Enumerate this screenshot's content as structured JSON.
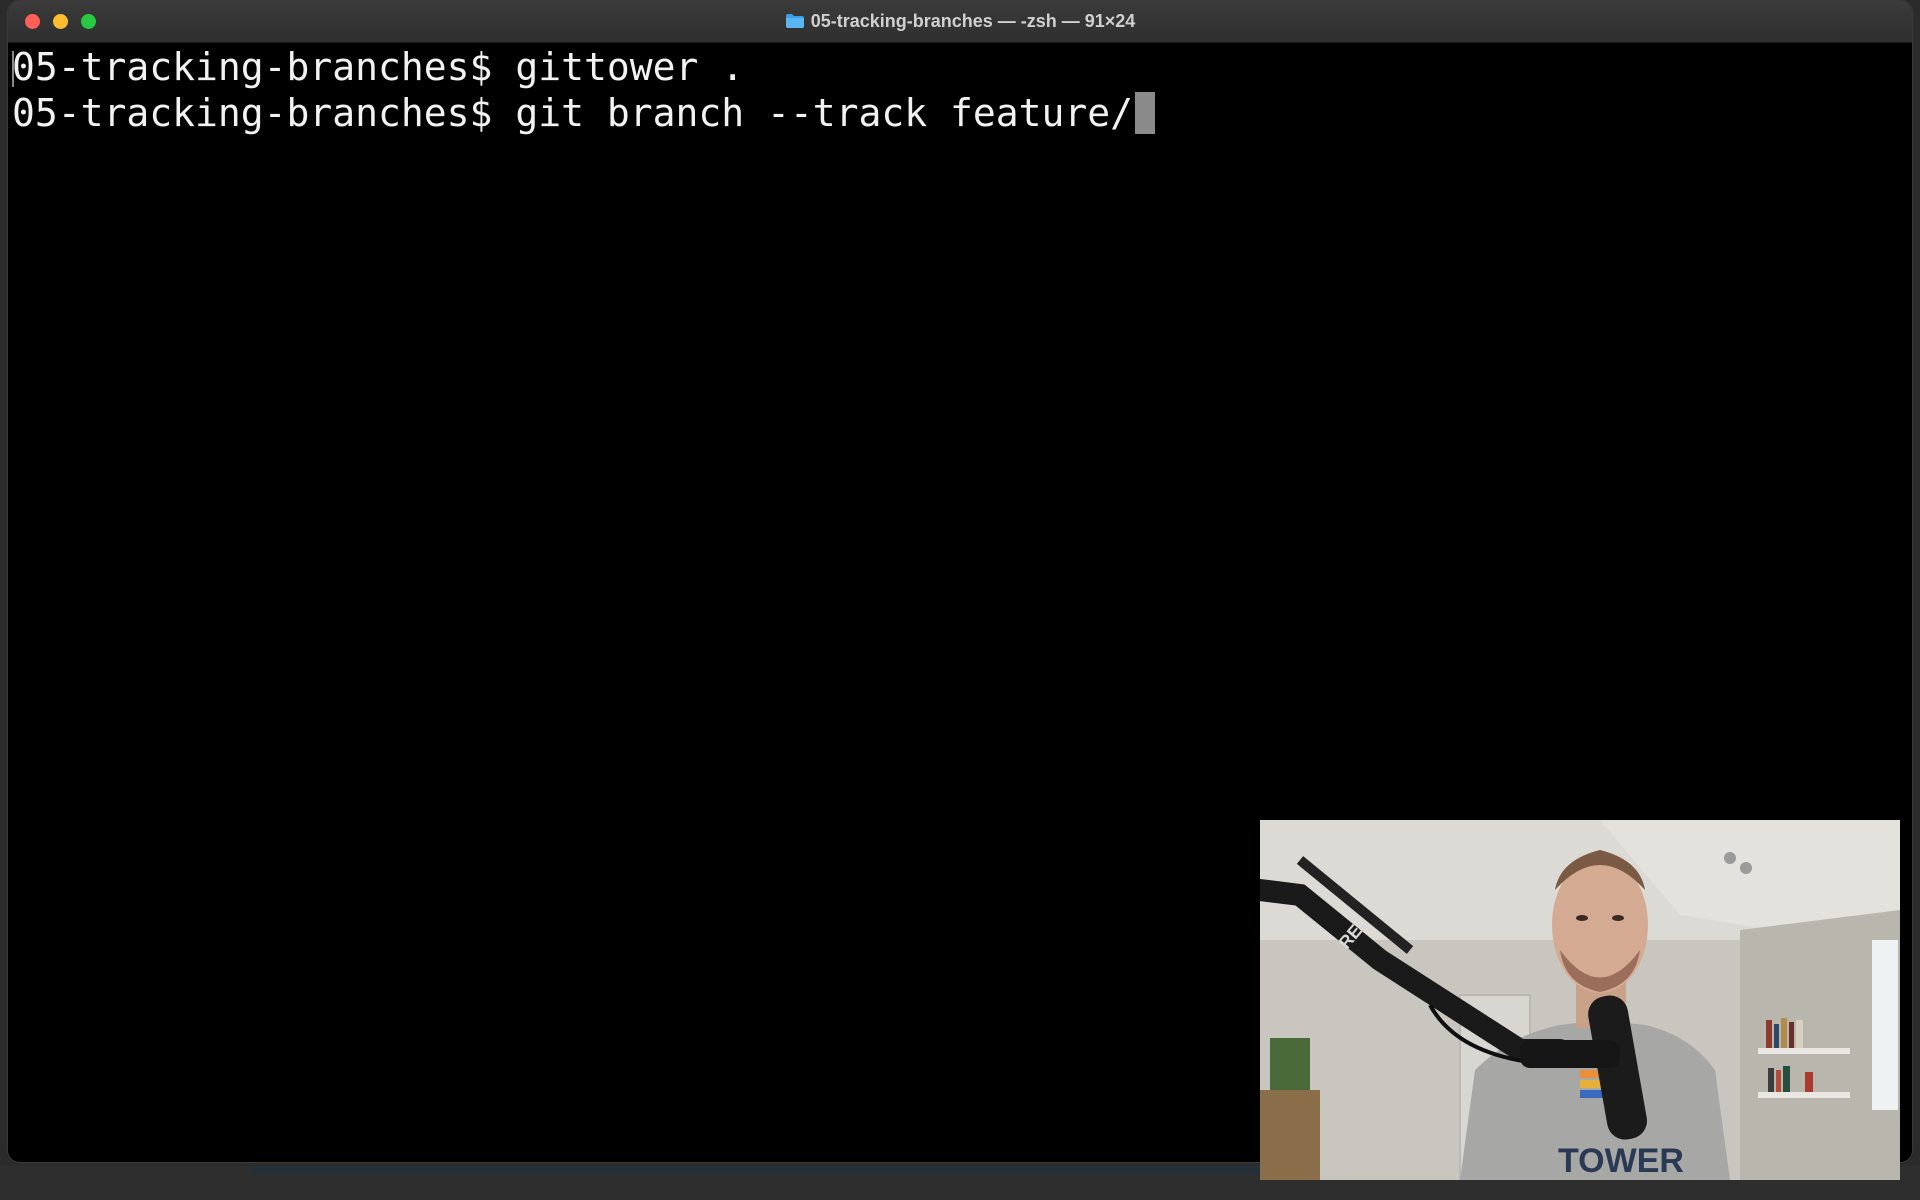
{
  "window": {
    "title": "05-tracking-branches — -zsh — 91×24"
  },
  "terminal": {
    "lines": [
      {
        "prompt": "05-tracking-branches$",
        "command": " gittower ."
      },
      {
        "prompt": "05-tracking-branches$",
        "command": " git branch --track feature/"
      }
    ]
  },
  "webcam": {
    "shirt_text": "TOWER",
    "mic_text": "RE"
  },
  "colors": {
    "close": "#fe5f57",
    "minimize": "#febc2e",
    "maximize": "#28c840",
    "terminal_bg": "#000000",
    "terminal_fg": "#f2f2f2",
    "folder": "#3aa0e8"
  },
  "icons": [
    "folder-icon",
    "close-icon",
    "minimize-icon",
    "maximize-icon"
  ]
}
